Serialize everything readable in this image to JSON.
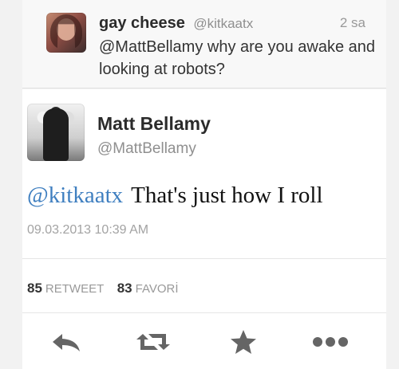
{
  "reply_tweet": {
    "name": "gay cheese",
    "handle": "@kitkaatx",
    "time": "2 sa",
    "text": "@MattBellamy why are you awake and looking at robots?"
  },
  "main_tweet": {
    "name": "Matt Bellamy",
    "handle": "@MattBellamy",
    "mention": "@kitkaatx",
    "text": "That's just how I roll",
    "datetime": "09.03.2013 10:39 AM"
  },
  "stats": {
    "retweets_count": "85",
    "retweets_label": "RETWEET",
    "favorites_count": "83",
    "favorites_label": "FAVORİ"
  },
  "actions": {
    "reply_icon": "reply-icon",
    "retweet_icon": "retweet-icon",
    "favorite_icon": "star-icon",
    "more_icon": "more-icon"
  },
  "colors": {
    "background": "#f2f2f2",
    "card": "#ffffff",
    "mention": "#3f7fc0",
    "muted": "#999999",
    "icon": "#656565"
  }
}
